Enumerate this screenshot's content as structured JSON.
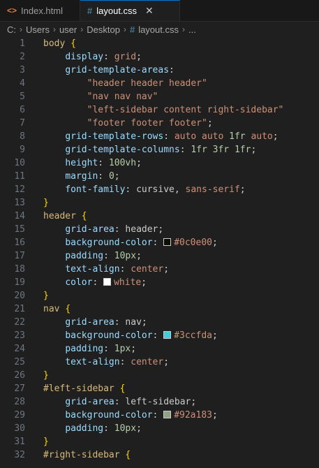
{
  "tabs": [
    {
      "label": "Index.html",
      "icon": "html-file-icon"
    },
    {
      "label": "layout.css",
      "icon": "css-file-icon",
      "active": true,
      "close": "✕"
    }
  ],
  "breadcrumb": {
    "parts": [
      "C:",
      "Users",
      "user",
      "Desktop",
      "layout.css",
      "..."
    ]
  },
  "colors": {
    "header_swatch": "#0c0e00",
    "white_swatch": "#ffffff",
    "nav_swatch": "#3ccfda",
    "sidebar_swatch": "#92a183"
  },
  "lines": [
    "1",
    "2",
    "3",
    "4",
    "5",
    "6",
    "7",
    "8",
    "9",
    "10",
    "11",
    "12",
    "13",
    "14",
    "15",
    "16",
    "17",
    "18",
    "19",
    "20",
    "21",
    "22",
    "23",
    "24",
    "25",
    "26",
    "27",
    "28",
    "29",
    "30",
    "31",
    "32"
  ],
  "code": {
    "l1": {
      "sel": "body",
      "brace": "{"
    },
    "l2": {
      "prop": "display",
      "val": "grid"
    },
    "l3": {
      "prop": "grid-template-areas"
    },
    "l4": "\"header header header\"",
    "l5": "\"nav nav nav\"",
    "l6": "\"left-sidebar content right-sidebar\"",
    "l7": "\"footer footer footer\"",
    "l8": {
      "prop": "grid-template-rows",
      "a": "auto",
      "b": "auto",
      "n": "1",
      "u": "fr",
      "c": "auto"
    },
    "l9": {
      "prop": "grid-template-columns",
      "n1": "1",
      "u1": "fr",
      "n2": "3",
      "u2": "fr",
      "n3": "1",
      "u3": "fr"
    },
    "l10": {
      "prop": "height",
      "n": "100",
      "u": "vh"
    },
    "l11": {
      "prop": "margin",
      "n": "0"
    },
    "l12": {
      "prop": "font-family",
      "a": "cursive",
      "b": "sans-serif"
    },
    "l13": "}",
    "l14": {
      "sel": "header",
      "brace": "{"
    },
    "l15": {
      "prop": "grid-area",
      "val": "header"
    },
    "l16": {
      "prop": "background-color",
      "val": "#0c0e00"
    },
    "l17": {
      "prop": "padding",
      "n": "10",
      "u": "px"
    },
    "l18": {
      "prop": "text-align",
      "val": "center"
    },
    "l19": {
      "prop": "color",
      "val": "white"
    },
    "l20": "}",
    "l21": {
      "sel": "nav",
      "brace": "{"
    },
    "l22": {
      "prop": "grid-area",
      "val": "nav"
    },
    "l23": {
      "prop": "background-color",
      "val": "#3ccfda"
    },
    "l24": {
      "prop": "padding",
      "n": "1",
      "u": "px"
    },
    "l25": {
      "prop": "text-align",
      "val": "center"
    },
    "l26": "}",
    "l27": {
      "sel": "#left-sidebar",
      "brace": "{"
    },
    "l28": {
      "prop": "grid-area",
      "val": "left-sidebar"
    },
    "l29": {
      "prop": "background-color",
      "val": "#92a183"
    },
    "l30": {
      "prop": "padding",
      "n": "10",
      "u": "px"
    },
    "l31": "}",
    "l32": {
      "sel": "#right-sidebar",
      "brace": "{"
    }
  }
}
